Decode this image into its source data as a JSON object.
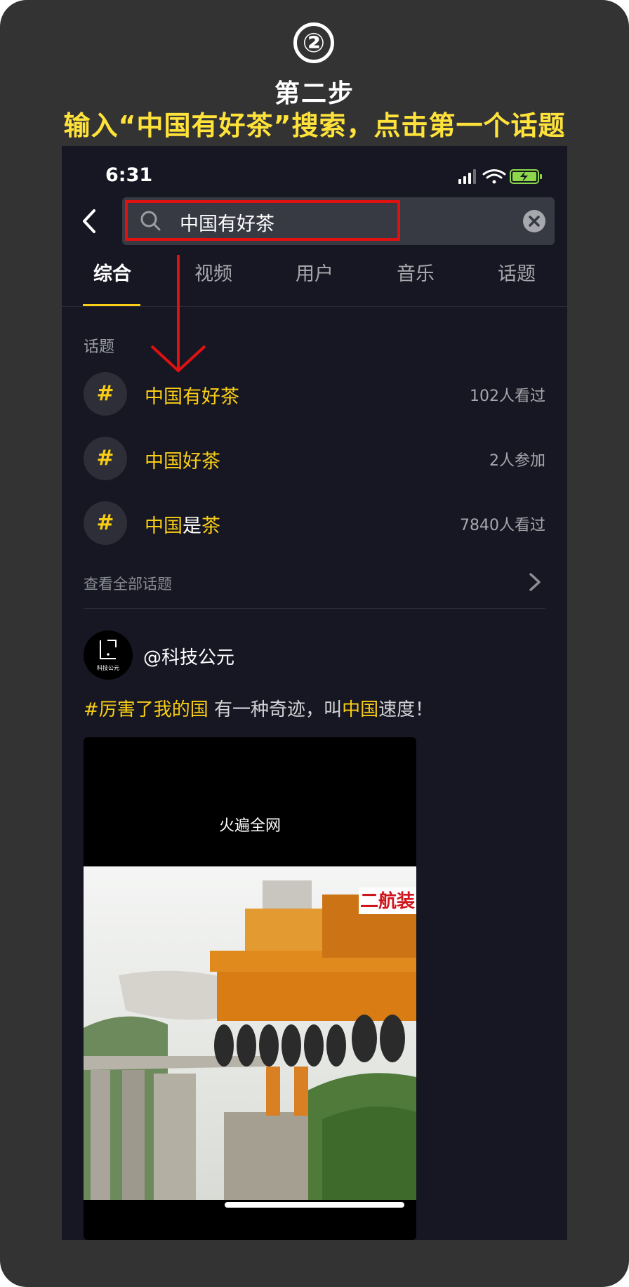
{
  "overlay": {
    "step_number": "②",
    "step_title": "第二步",
    "instruction": "输入“中国有好茶”搜索，点击第一个话题"
  },
  "status_bar": {
    "time": "6:31"
  },
  "search": {
    "query": "中国有好茶"
  },
  "tabs": [
    {
      "label": "综合",
      "active": true
    },
    {
      "label": "视频",
      "active": false
    },
    {
      "label": "用户",
      "active": false
    },
    {
      "label": "音乐",
      "active": false
    },
    {
      "label": "话题",
      "active": false
    }
  ],
  "topics_section": {
    "label": "话题",
    "items": [
      {
        "badge": "#",
        "name": "中国有好茶",
        "count": "102人看过"
      },
      {
        "badge": "#",
        "name": "中国好茶",
        "count": "2人参加"
      },
      {
        "badge": "#",
        "name_highlight_1": "中国",
        "name_plain": "是",
        "name_highlight_2": "茶",
        "count": "7840人看过"
      }
    ],
    "view_all": "查看全部话题"
  },
  "post": {
    "avatar_caption": "科技公元",
    "username": "@科技公元",
    "caption_hashtag": "#厉害了我的国",
    "caption_text_1": " 有一种奇迹，叫",
    "caption_highlight": "中国",
    "caption_text_2": "速度！",
    "video_title": "火遍全网",
    "video_sign": "二航装"
  },
  "colors": {
    "accent": "#face15",
    "app_background": "#161722",
    "outer_background": "#333333",
    "highlight_box": "#e01111",
    "instruction_text": "#ffe33a"
  }
}
